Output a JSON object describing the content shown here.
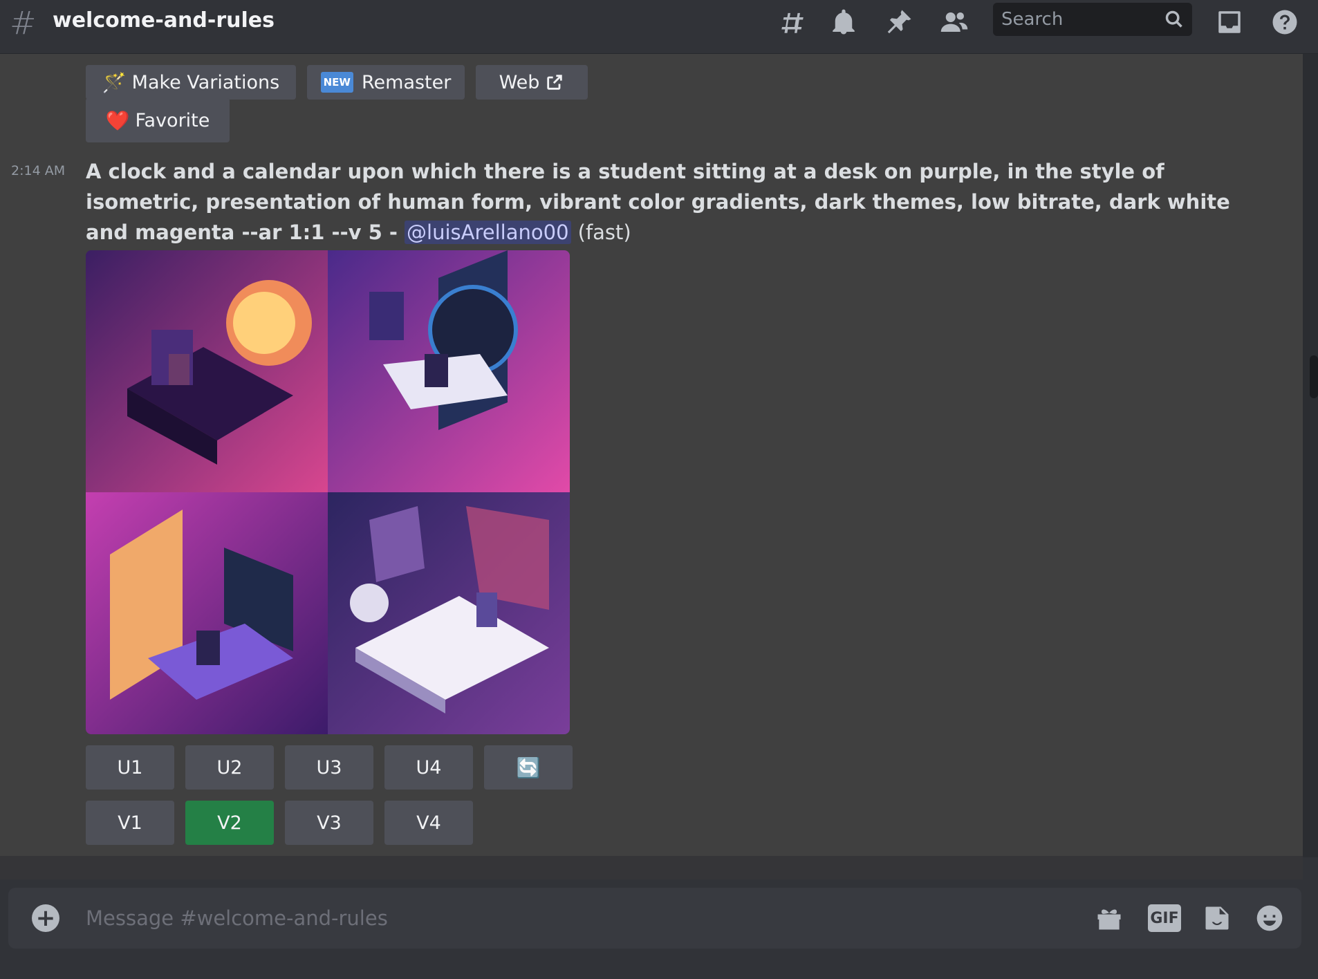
{
  "header": {
    "channel_name": "welcome-and-rules",
    "hash_glyph": "#",
    "search_placeholder": "Search",
    "icons": [
      "threads-icon",
      "bell-icon",
      "pin-icon",
      "members-icon",
      "search-icon",
      "inbox-icon",
      "help-icon"
    ]
  },
  "top_buttons": {
    "make_variations": "Make Variations",
    "make_variations_emoji": "🪄",
    "remaster_badge": "NEW",
    "remaster": "Remaster",
    "web": "Web",
    "favorite": "Favorite",
    "favorite_emoji": "❤️"
  },
  "message": {
    "timestamp": "2:14 AM",
    "prompt_text": "A clock and a calendar upon which there is a student sitting at a desk on purple, in the style of isometric, presentation of human form, vibrant color gradients, dark themes, low bitrate, dark white and magenta --ar 1:1 --v 5 -",
    "mention": "@luisArellano00",
    "speed": "(fast)"
  },
  "image_grid": {
    "tiles": [
      {
        "name": "image-1",
        "colors": [
          "#3b1f63",
          "#d8468f"
        ]
      },
      {
        "name": "image-2",
        "colors": [
          "#4a2a8a",
          "#e24aa8"
        ]
      },
      {
        "name": "image-3",
        "colors": [
          "#c43fb0",
          "#3c1b6a"
        ]
      },
      {
        "name": "image-4",
        "colors": [
          "#2c2560",
          "#7a3e9a"
        ]
      }
    ]
  },
  "action_buttons": {
    "upscale": [
      "U1",
      "U2",
      "U3",
      "U4"
    ],
    "variation": [
      "V1",
      "V2",
      "V3",
      "V4"
    ],
    "reroll_icon": "🔄",
    "selected": "V2"
  },
  "composer": {
    "placeholder": "Message #welcome-and-rules",
    "gif_label": "GIF",
    "icons": [
      "add-icon",
      "gift-icon",
      "gif-icon",
      "sticker-icon",
      "emoji-icon"
    ]
  },
  "colors": {
    "background": "#313338",
    "message_bg": "#404040",
    "button": "#4e5058",
    "selected_button": "#248046",
    "mention_bg": "#3c4270"
  }
}
